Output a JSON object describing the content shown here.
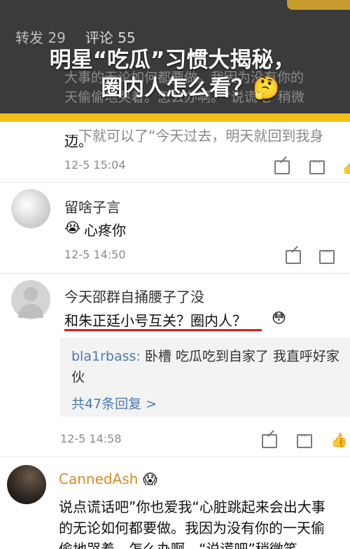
{
  "header": {
    "tabs": [
      "转发 29",
      "评论 55"
    ],
    "title_line1": "明星“吃瓜”习惯大揭秘，",
    "title_line2": "圈内人怎么看？🤔",
    "bg_line1": "大事的无论如何都要做。我因为没有你的",
    "bg_line2": "天偷偷地哭着。怎么办啊。“说谎吧”稍微"
  },
  "first_comment": {
    "partial_line": "一下就可以了“今天过去，明天就回到我身",
    "tail": "边。",
    "time": "12-5 15:04"
  },
  "comments": [
    {
      "name": "留啥子言",
      "emoji": "😭",
      "text": "心疼你",
      "time": "12-5 14:50"
    },
    {
      "name": "今天邵群自捅腰子了没",
      "text": "和朱正廷小号互关？圈内人？",
      "emoji": "😳",
      "reply": {
        "user": "bla1rbass:",
        "text_line1": " 卧槽 吃瓜吃到自家了 我直呼好家",
        "text_line2": "伙",
        "more": "共47条回复 >"
      },
      "time": "12-5 14:58"
    },
    {
      "name": "CannedAsh",
      "emoji": "😱",
      "line1": "说点谎话吧”你也爱我“心脏跳起来会出大事",
      "line2": "的无论如何都要做。我因为没有你的一天偷",
      "line3": "偷地哭着。怎么办啊。“说谎吧”稍微笑"
    }
  ],
  "icons": {
    "edit": "share-edit-icon",
    "chat": "comment-icon",
    "like": "like-icon"
  },
  "colors": {
    "banner": "#3b3b3b",
    "accent_yellow": "#f2c019",
    "link_blue": "#4a7ab0",
    "underline_red": "#cc2020"
  }
}
